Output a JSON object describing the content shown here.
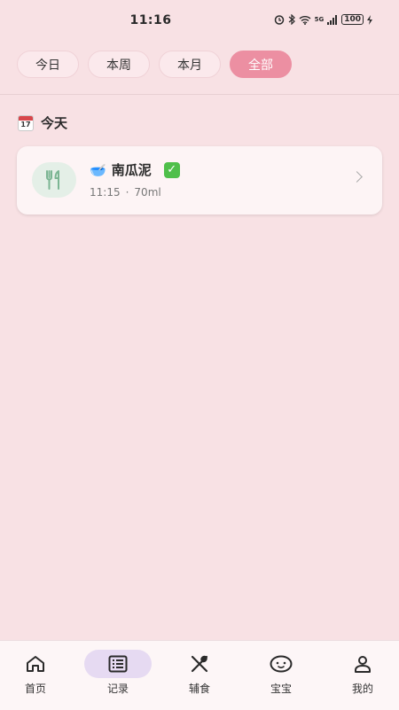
{
  "status_bar": {
    "time": "11:16",
    "network": "5G",
    "battery": "100"
  },
  "filters": [
    {
      "label": "今日",
      "active": false
    },
    {
      "label": "本周",
      "active": false
    },
    {
      "label": "本月",
      "active": false
    },
    {
      "label": "全部",
      "active": true
    }
  ],
  "section": {
    "icon_day": "17",
    "title": "今天"
  },
  "records": [
    {
      "emoji": "🥣",
      "name": "南瓜泥",
      "done_mark": "✓",
      "time": "11:15",
      "separator": "·",
      "amount": "70ml"
    }
  ],
  "bottom_nav": [
    {
      "label": "首页",
      "icon": "home-icon",
      "active": false
    },
    {
      "label": "记录",
      "icon": "list-icon",
      "active": true
    },
    {
      "label": "辅食",
      "icon": "utensils-icon",
      "active": false
    },
    {
      "label": "宝宝",
      "icon": "baby-face-icon",
      "active": false
    },
    {
      "label": "我的",
      "icon": "person-icon",
      "active": false
    }
  ],
  "colors": {
    "background": "#f8e1e4",
    "accent": "#ec8fa2",
    "active_nav": "#e6daf2",
    "check": "#4fbf4a",
    "icon_green": "#7bb593"
  }
}
